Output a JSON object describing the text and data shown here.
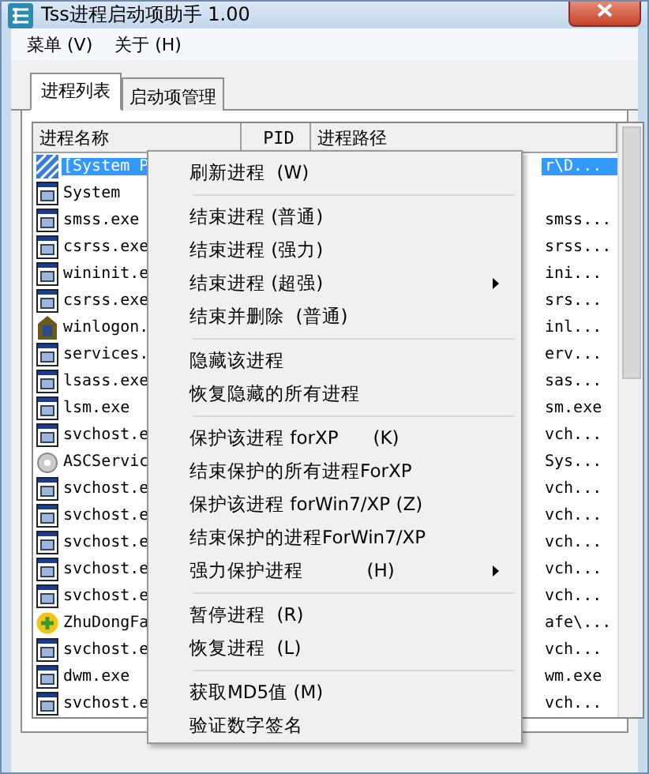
{
  "window": {
    "title": "Tss进程启动项助手 1.00"
  },
  "menu_bar": [
    "菜单 (V)",
    "关于 (H)"
  ],
  "tabs": [
    {
      "label": "进程列表",
      "selected": true
    },
    {
      "label": "启动项管理",
      "selected": false
    }
  ],
  "table": {
    "columns": [
      "进程名称",
      "PID",
      "进程路径"
    ],
    "rows": [
      {
        "kind": "system",
        "name": "[System P",
        "path": "r\\D...",
        "selected": true
      },
      {
        "kind": "app",
        "name": "System",
        "path": "",
        "selected": false
      },
      {
        "kind": "app",
        "name": "smss.exe",
        "path": "smss...",
        "selected": false
      },
      {
        "kind": "app",
        "name": "csrss.exe",
        "path": "srss...",
        "selected": false
      },
      {
        "kind": "app",
        "name": "wininit.e",
        "path": "ini...",
        "selected": false
      },
      {
        "kind": "app",
        "name": "csrss.exe",
        "path": "srs...",
        "selected": false
      },
      {
        "kind": "logon",
        "name": "winlogon.",
        "path": "inl...",
        "selected": false
      },
      {
        "kind": "app",
        "name": "services.",
        "path": "erv...",
        "selected": false
      },
      {
        "kind": "app",
        "name": "lsass.exe",
        "path": "sas...",
        "selected": false
      },
      {
        "kind": "app",
        "name": "lsm.exe",
        "path": "sm.exe",
        "selected": false
      },
      {
        "kind": "app",
        "name": "svchost.e",
        "path": "vch...",
        "selected": false
      },
      {
        "kind": "service",
        "name": "ASCServic",
        "path": "Sys...",
        "selected": false
      },
      {
        "kind": "app",
        "name": "svchost.e",
        "path": "vch...",
        "selected": false
      },
      {
        "kind": "app",
        "name": "svchost.e",
        "path": "vch...",
        "selected": false
      },
      {
        "kind": "app",
        "name": "svchost.e",
        "path": "vch...",
        "selected": false
      },
      {
        "kind": "app",
        "name": "svchost.e",
        "path": "vch...",
        "selected": false
      },
      {
        "kind": "app",
        "name": "svchost.e",
        "path": "vch...",
        "selected": false
      },
      {
        "kind": "plus",
        "name": "ZhuDongFa",
        "path": "afe\\...",
        "selected": false
      },
      {
        "kind": "app",
        "name": "svchost.e",
        "path": "vch...",
        "selected": false
      },
      {
        "kind": "app",
        "name": "dwm.exe",
        "path": "wm.exe",
        "selected": false
      },
      {
        "kind": "app",
        "name": "svchost.e",
        "path": "vch...",
        "selected": false
      }
    ]
  },
  "context_menu": [
    [
      {
        "label": "刷新进程  (W)",
        "submenu": false
      }
    ],
    [
      {
        "label": "结束进程 (普通)",
        "submenu": false
      },
      {
        "label": "结束进程 (强力)",
        "submenu": false
      },
      {
        "label": "结束进程 (超强)",
        "submenu": true
      },
      {
        "label": "结束并删除  (普通)",
        "submenu": false
      }
    ],
    [
      {
        "label": "隐藏该进程",
        "submenu": false
      },
      {
        "label": "恢复隐藏的所有进程",
        "submenu": false
      }
    ],
    [
      {
        "label": "保护该进程 forXP      (K)",
        "submenu": false
      },
      {
        "label": "结束保护的所有进程ForXP",
        "submenu": false
      },
      {
        "label": "保护该进程 forWin7/XP (Z)",
        "submenu": false
      },
      {
        "label": "结束保护的进程ForWin7/XP",
        "submenu": false
      },
      {
        "label": "强力保护进程           (H)",
        "submenu": true
      }
    ],
    [
      {
        "label": "暂停进程  (R)",
        "submenu": false
      },
      {
        "label": "恢复进程  (L)",
        "submenu": false
      }
    ],
    [
      {
        "label": "获取MD5值 (M)",
        "submenu": false
      },
      {
        "label": "验证数字签名",
        "submenu": false
      }
    ]
  ]
}
